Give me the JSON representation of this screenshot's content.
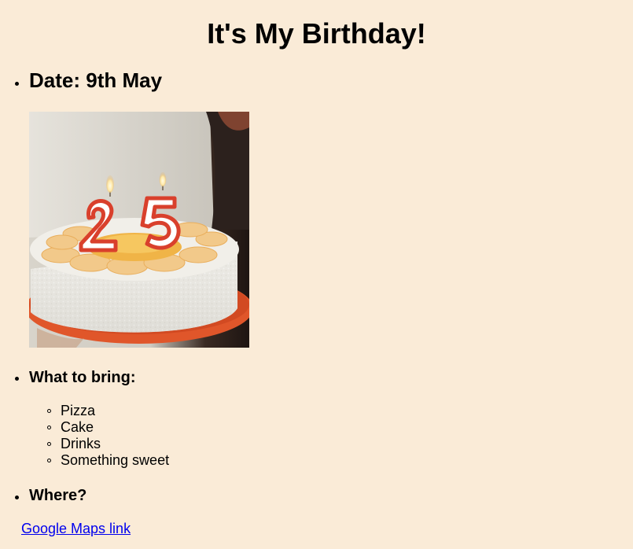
{
  "page": {
    "title": "It's My Birthday!"
  },
  "date": {
    "label": "Date: 9th May"
  },
  "cake_image": {
    "alt": "Birthday cake with 25 candles",
    "candle_digits": "25"
  },
  "bring": {
    "heading": "What to bring:",
    "items": [
      "Pizza",
      "Cake",
      "Drinks",
      "Something sweet"
    ]
  },
  "where": {
    "heading": "Where?",
    "link_text": "Google Maps link"
  },
  "colors": {
    "background": "#faebd7",
    "link": "#0000ee"
  }
}
